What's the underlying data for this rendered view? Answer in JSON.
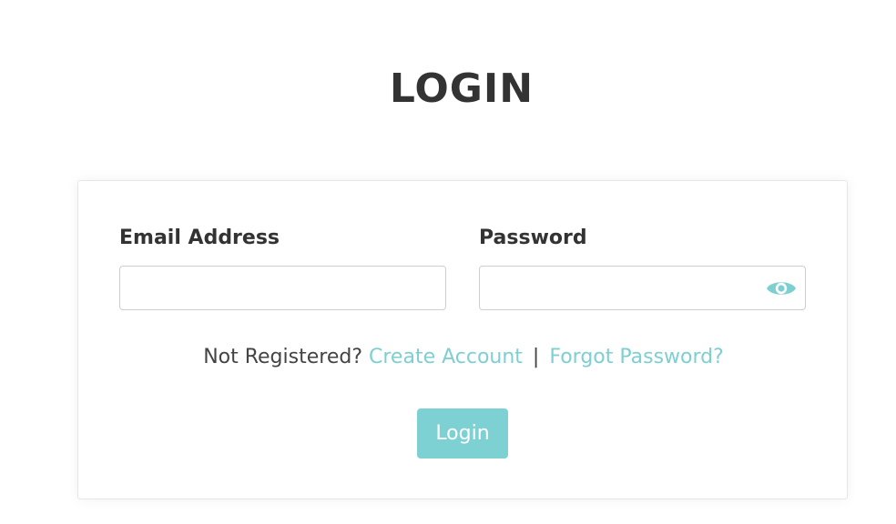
{
  "page": {
    "title": "LOGIN"
  },
  "form": {
    "email_label": "Email Address",
    "email_value": "",
    "email_placeholder": "",
    "password_label": "Password",
    "password_value": "",
    "password_placeholder": "",
    "show_password_icon": "eye-icon"
  },
  "links": {
    "not_registered_text": "Not Registered?",
    "create_account_label": "Create Account",
    "separator": "|",
    "forgot_password_label": "Forgot Password?"
  },
  "actions": {
    "login_label": "Login"
  },
  "colors": {
    "accent": "#7dd1d3",
    "text": "#333333",
    "border": "#cfcfcf"
  }
}
